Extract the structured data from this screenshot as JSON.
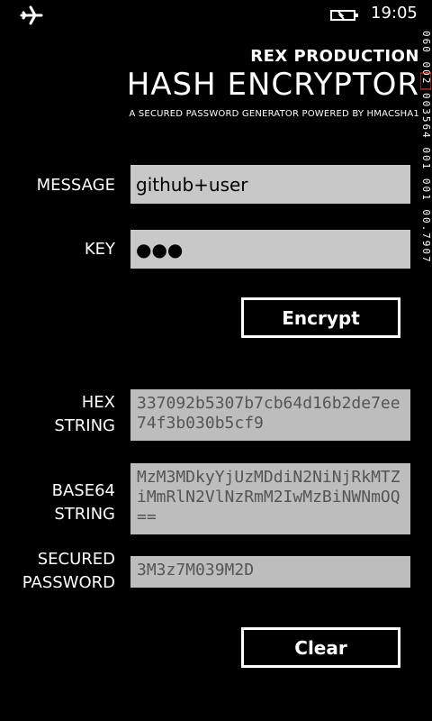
{
  "status_bar": {
    "time": "19:05",
    "airplane_icon": "airplane-icon",
    "battery_icon": "battery-charging-icon"
  },
  "header": {
    "brand": "REX PRODUCTION",
    "title": "HASH ENCRYPTOR",
    "subtitle": "A SECURED PASSWORD GENERATOR POWERED BY HMACSHA1"
  },
  "form": {
    "message_label": "MESSAGE",
    "message_value": "github+user",
    "key_label": "KEY",
    "key_value": "●●●",
    "encrypt_label": "Encrypt"
  },
  "results": {
    "hex_label_1": "HEX",
    "hex_label_2": "STRING",
    "hex_value": "337092b5307b7cb64d16b2de7ee74f3b030b5cf9",
    "base64_label_1": "BASE64",
    "base64_label_2": "STRING",
    "base64_value": "MzM3MDkyYjUzMDdiN2NiNjRkMTZiMmRlN2VlNzRmM2IwMzBiNWNmOQ==",
    "secured_label_1": "SECURED",
    "secured_label_2": "PASSWORD",
    "secured_value": "3M3z7M039M2D",
    "clear_label": "Clear"
  },
  "debug_overlay": {
    "text": "060 002 003564 001 001 00.7907"
  },
  "colors": {
    "background": "#000000",
    "field": "#c8c8c8",
    "readonly_text": "#555555",
    "accent_debug": "#ff3b30"
  }
}
